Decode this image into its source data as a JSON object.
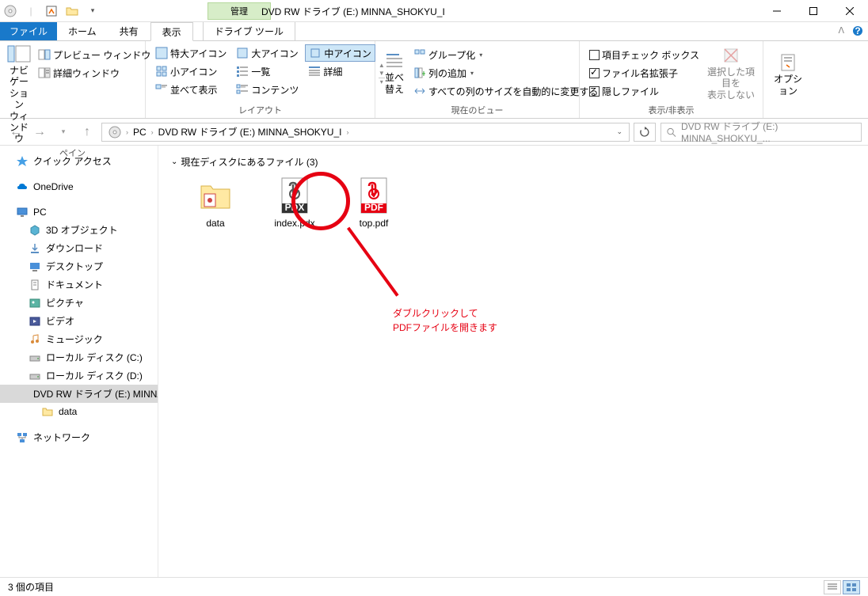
{
  "titlebar": {
    "contextual_tab": "管理",
    "title": "DVD RW ドライブ (E:) MINNA_SHOKYU_I"
  },
  "tabs": {
    "file": "ファイル",
    "home": "ホーム",
    "share": "共有",
    "view": "表示",
    "drive_tools": "ドライブ ツール"
  },
  "ribbon": {
    "panes": {
      "nav_pane": "ナビゲーション\nウィンドウ",
      "preview": "プレビュー ウィンドウ",
      "details": "詳細ウィンドウ",
      "label": "ペイン"
    },
    "layout": {
      "extra_large": "特大アイコン",
      "large": "大アイコン",
      "medium": "中アイコン",
      "small": "小アイコン",
      "list": "一覧",
      "details": "詳細",
      "tiles": "並べて表示",
      "content": "コンテンツ",
      "label": "レイアウト"
    },
    "current_view": {
      "sort": "並べ替え",
      "group": "グループ化",
      "add_column": "列の追加",
      "size_all": "すべての列のサイズを自動的に変更する",
      "label": "現在のビュー"
    },
    "show_hide": {
      "item_check": "項目チェック ボックス",
      "extensions": "ファイル名拡張子",
      "hidden": "隠しファイル",
      "hide_selected": "選択した項目を\n表示しない",
      "label": "表示/非表示"
    },
    "options": {
      "label_btn": "オプション"
    }
  },
  "address": {
    "pc": "PC",
    "drive": "DVD RW ドライブ (E:) MINNA_SHOKYU_I"
  },
  "search": {
    "placeholder": "DVD RW ドライブ (E:) MINNA_SHOKYU_..."
  },
  "sidebar": {
    "quick_access": "クイック アクセス",
    "onedrive": "OneDrive",
    "pc": "PC",
    "objects3d": "3D オブジェクト",
    "downloads": "ダウンロード",
    "desktop": "デスクトップ",
    "documents": "ドキュメント",
    "pictures": "ピクチャ",
    "videos": "ビデオ",
    "music": "ミュージック",
    "disk_c": "ローカル ディスク (C:)",
    "disk_d": "ローカル ディスク (D:)",
    "dvd": "DVD RW ドライブ (E:) MINNA_S",
    "data_folder": "data",
    "network": "ネットワーク"
  },
  "content": {
    "group_header": "現在ディスクにあるファイル (3)",
    "files": {
      "data": "data",
      "index": "index.pdx",
      "top": "top.pdf"
    }
  },
  "annotation": {
    "line1": "ダブルクリックして",
    "line2": "PDFファイルを開きます"
  },
  "statusbar": {
    "count": "3 個の項目"
  }
}
